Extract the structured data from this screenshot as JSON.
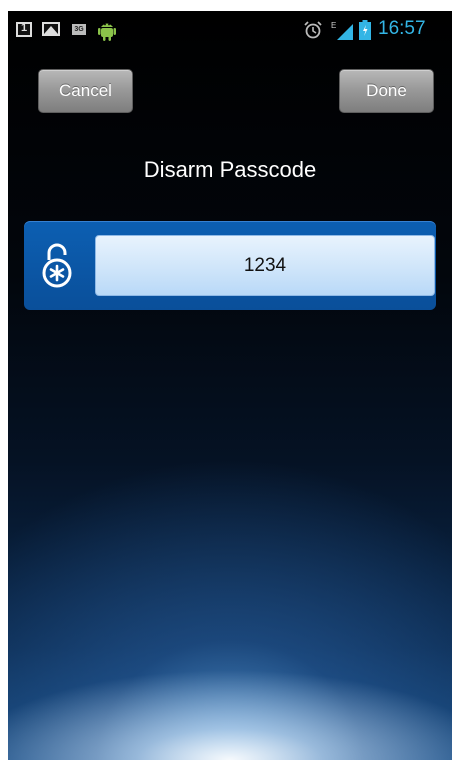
{
  "status_bar": {
    "time": "16:57",
    "time_color": "#33b5e5",
    "icons": [
      "calendar-icon",
      "gallery-icon",
      "3g-icon",
      "android-icon",
      "alarm-icon",
      "signal-icon",
      "battery-icon"
    ],
    "network_badge": "3G",
    "signal_type": "E"
  },
  "toolbar": {
    "cancel_label": "Cancel",
    "done_label": "Done"
  },
  "title": "Disarm Passcode",
  "passcode": {
    "value": "1234",
    "icon": "lock-icon",
    "panel_color": "#0b56a6"
  }
}
